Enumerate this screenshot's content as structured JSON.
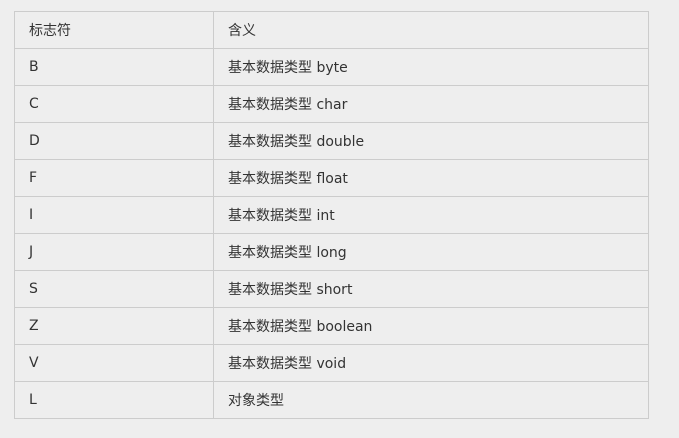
{
  "table": {
    "headers": [
      "标志符",
      "含义"
    ],
    "rows": [
      {
        "symbol": "B",
        "meaning": "基本数据类型 byte"
      },
      {
        "symbol": "C",
        "meaning": "基本数据类型 char"
      },
      {
        "symbol": "D",
        "meaning": "基本数据类型 double"
      },
      {
        "symbol": "F",
        "meaning": "基本数据类型 float"
      },
      {
        "symbol": "I",
        "meaning": "基本数据类型 int"
      },
      {
        "symbol": "J",
        "meaning": "基本数据类型 long"
      },
      {
        "symbol": "S",
        "meaning": "基本数据类型 short"
      },
      {
        "symbol": "Z",
        "meaning": "基本数据类型 boolean"
      },
      {
        "symbol": "V",
        "meaning": "基本数据类型 void"
      },
      {
        "symbol": "L",
        "meaning": "对象类型"
      }
    ]
  }
}
